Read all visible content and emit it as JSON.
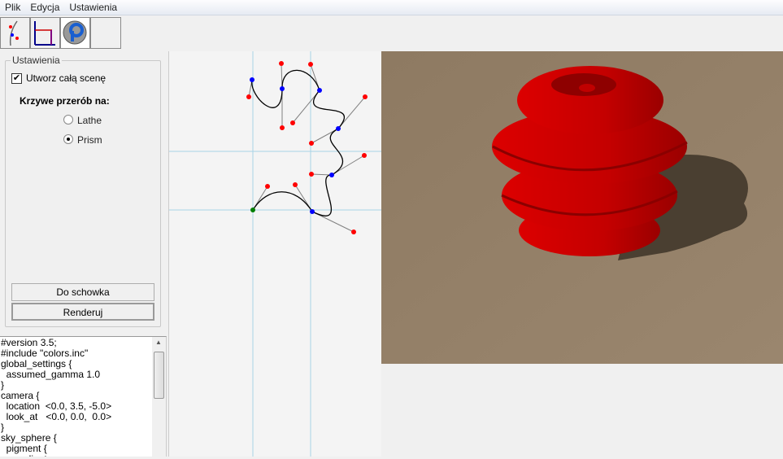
{
  "menu": [
    "Plik",
    "Edycja",
    "Ustawienia"
  ],
  "toolbar": {
    "buttons": [
      {
        "icon": "curve-edit-icon"
      },
      {
        "icon": "axes-icon"
      },
      {
        "icon": "povray-icon",
        "active": true
      },
      {
        "icon": "empty"
      }
    ]
  },
  "settings": {
    "group_title": "Ustawienia",
    "whole_scene_label": "Utworz całą scenę",
    "whole_scene_checked": true,
    "convert_label": "Krzywe przerób na:",
    "options": [
      {
        "label": "Lathe",
        "selected": false
      },
      {
        "label": "Prism",
        "selected": true
      }
    ],
    "clipboard_button": "Do schowka",
    "render_button": "Renderuj"
  },
  "code": "#version 3.5;\n#include \"colors.inc\"\nglobal_settings {\n  assumed_gamma 1.0\n}\ncamera {\n  location  <0.0, 3.5, -5.0>\n  look_at   <0.0, 0.0,  0.0>\n}\nsky_sphere {\n  pigment {\n    gradient y",
  "colors": {
    "anchor": "#0000ff",
    "start_anchor": "#007f00",
    "handle": "#ff0000",
    "grid": "#a8d4e6",
    "object": "#d40000",
    "floor": "#94806a"
  }
}
